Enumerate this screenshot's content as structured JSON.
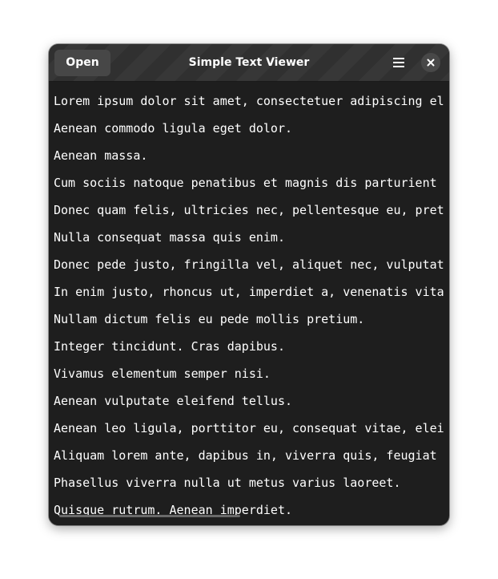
{
  "window": {
    "title": "Simple Text Viewer",
    "open_label": "Open"
  },
  "lines": [
    "Lorem ipsum dolor sit amet, consectetuer adipiscing el",
    "Aenean commodo ligula eget dolor.",
    "Aenean massa.",
    "Cum sociis natoque penatibus et magnis dis parturient m",
    "Donec quam felis, ultricies nec, pellentesque eu, pret",
    "Nulla consequat massa quis enim.",
    "Donec pede justo, fringilla vel, aliquet nec, vulputate",
    "In enim justo, rhoncus ut, imperdiet a, venenatis vitae",
    "Nullam dictum felis eu pede mollis pretium.",
    "Integer tincidunt. Cras dapibus.",
    "Vivamus elementum semper nisi.",
    "Aenean vulputate eleifend tellus.",
    "Aenean leo ligula, porttitor eu, consequat vitae, eleif",
    "Aliquam lorem ante, dapibus in, viverra quis, feugiat a",
    "Phasellus viverra nulla ut metus varius laoreet.",
    "Quisque rutrum. Aenean imperdiet."
  ],
  "icons": {
    "menu": "hamburger-menu-icon",
    "close": "close-icon"
  },
  "colors": {
    "background": "#1e1e1e",
    "headerbar": "#303030",
    "text": "#ffffff",
    "button": "#474747"
  }
}
